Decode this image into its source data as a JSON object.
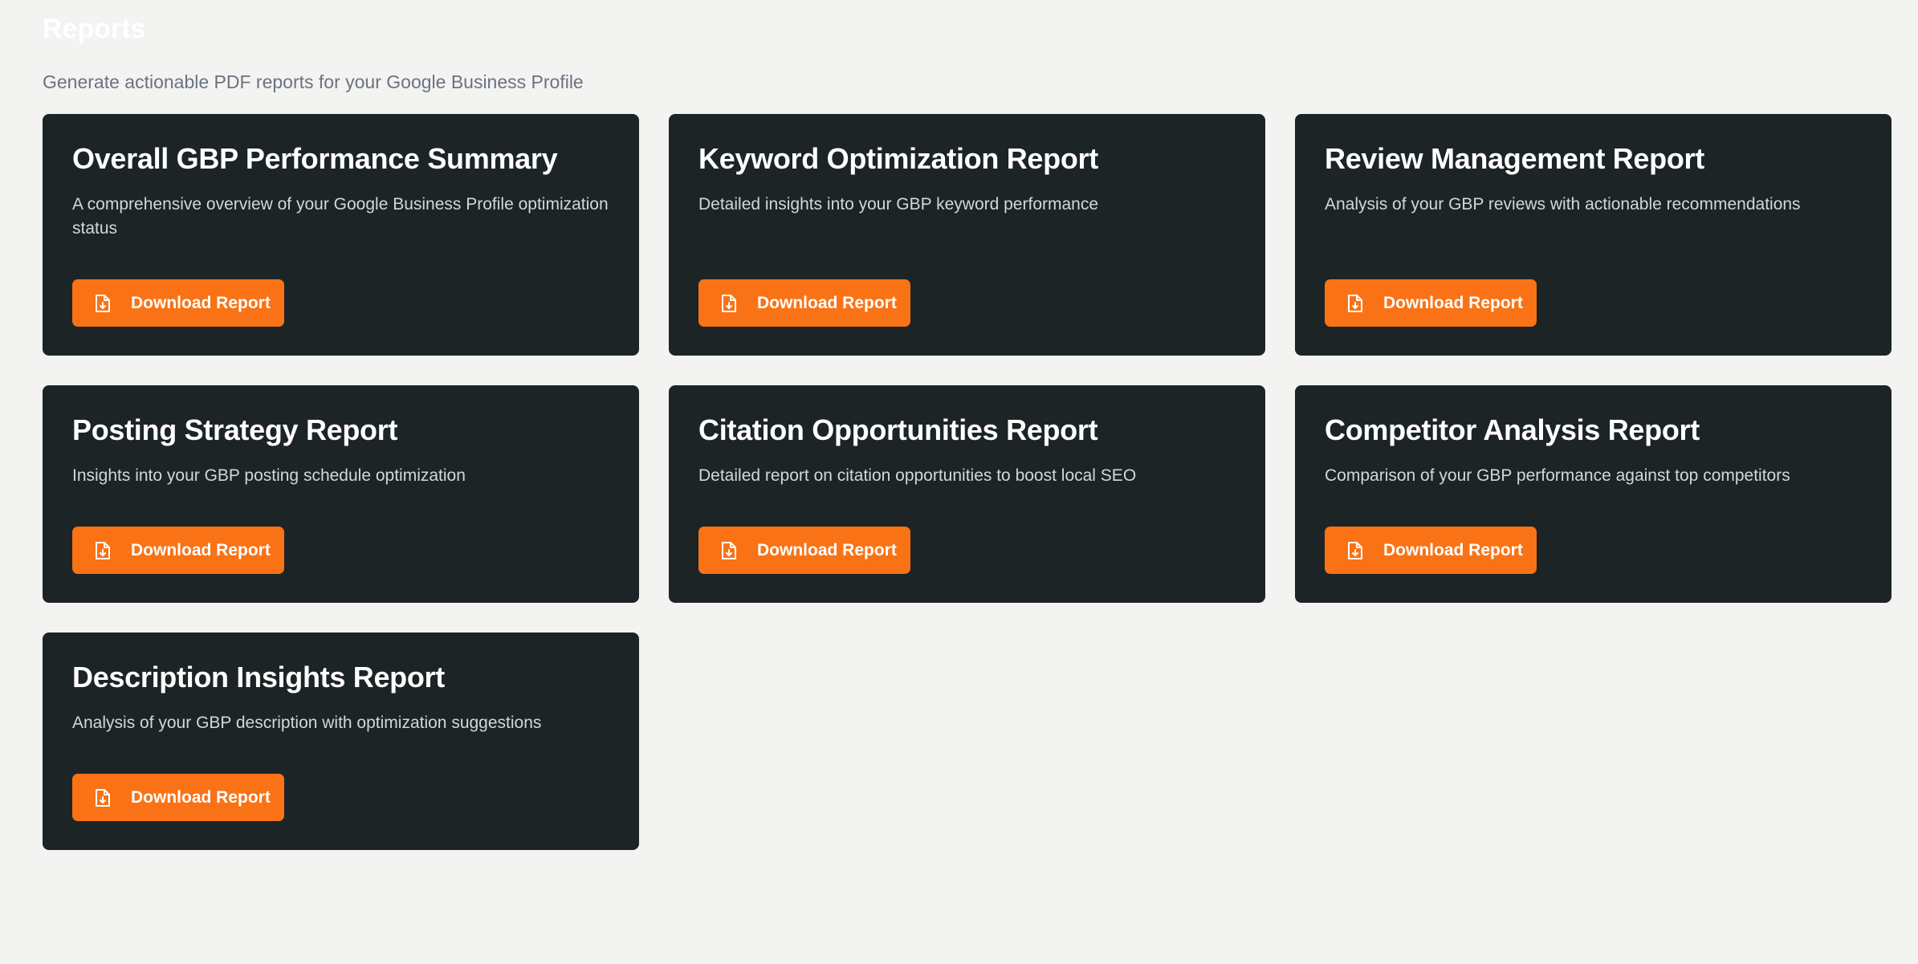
{
  "header": {
    "title": "Reports",
    "subtitle": "Generate actionable PDF reports for your Google Business Profile"
  },
  "colors": {
    "background": "#f3f3f1",
    "card": "#1d2426",
    "accent": "#f97316"
  },
  "reports": [
    {
      "title": "Overall GBP Performance Summary",
      "description": "A comprehensive overview of your Google Business Profile optimization status",
      "button_label": "Download Report",
      "button_icon": "file-download-icon"
    },
    {
      "title": "Keyword Optimization Report",
      "description": "Detailed insights into your GBP keyword performance",
      "button_label": "Download Report",
      "button_icon": "file-download-icon"
    },
    {
      "title": "Review Management Report",
      "description": "Analysis of your GBP reviews with actionable recommendations",
      "button_label": "Download Report",
      "button_icon": "file-download-icon"
    },
    {
      "title": "Posting Strategy Report",
      "description": "Insights into your GBP posting schedule optimization",
      "button_label": "Download Report",
      "button_icon": "file-download-icon"
    },
    {
      "title": "Citation Opportunities Report",
      "description": "Detailed report on citation opportunities to boost local SEO",
      "button_label": "Download Report",
      "button_icon": "file-download-icon"
    },
    {
      "title": "Competitor Analysis Report",
      "description": "Comparison of your GBP performance against top competitors",
      "button_label": "Download Report",
      "button_icon": "file-download-icon"
    },
    {
      "title": "Description Insights Report",
      "description": "Analysis of your GBP description with optimization suggestions",
      "button_label": "Download Report",
      "button_icon": "file-download-icon"
    }
  ]
}
